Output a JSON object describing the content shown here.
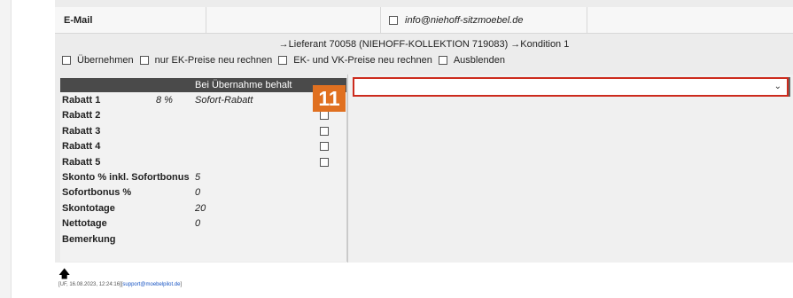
{
  "email": {
    "label": "E-Mail",
    "value": "info@niehoff-sitzmoebel.de"
  },
  "supplier_line": "→Lieferant 70058 (NIEHOFF-KOLLEKTION 719083) →Kondition 1",
  "options": {
    "uebernehmen": "Übernehmen",
    "ek_only": "nur EK-Preise neu rechnen",
    "ek_vk": "EK- und VK-Preise neu rechnen",
    "ausblenden": "Ausblenden"
  },
  "table": {
    "header": "Bei Übernahme behalt",
    "rows": [
      {
        "label": "Rabatt 1",
        "pct": "8 %",
        "value": "Sofort-Rabatt",
        "has_checkbox": true
      },
      {
        "label": "Rabatt 2",
        "pct": "",
        "value": "",
        "has_checkbox": true
      },
      {
        "label": "Rabatt 3",
        "pct": "",
        "value": "",
        "has_checkbox": true
      },
      {
        "label": "Rabatt 4",
        "pct": "",
        "value": "",
        "has_checkbox": true
      },
      {
        "label": "Rabatt 5",
        "pct": "",
        "value": "",
        "has_checkbox": true
      },
      {
        "label": "Skonto % inkl. Sofortbonus",
        "pct": "",
        "value": "5",
        "has_checkbox": false
      },
      {
        "label": "Sofortbonus %",
        "pct": "",
        "value": "0",
        "has_checkbox": false
      },
      {
        "label": "Skontotage",
        "pct": "",
        "value": "20",
        "has_checkbox": false
      },
      {
        "label": "Nettotage",
        "pct": "",
        "value": "0",
        "has_checkbox": false
      },
      {
        "label": "Bemerkung",
        "pct": "",
        "value": "",
        "has_checkbox": false
      }
    ]
  },
  "dropdown": {
    "value": ""
  },
  "step_badge": "11",
  "footer": {
    "prefix": "[UF, 16.08.2023, 12:24:16][",
    "link": "support@moebelpilot.de",
    "suffix": "]"
  },
  "colors": {
    "badge": "#e07020",
    "highlight_border": "#cc2b1d",
    "table_header": "#4a4a4a"
  }
}
